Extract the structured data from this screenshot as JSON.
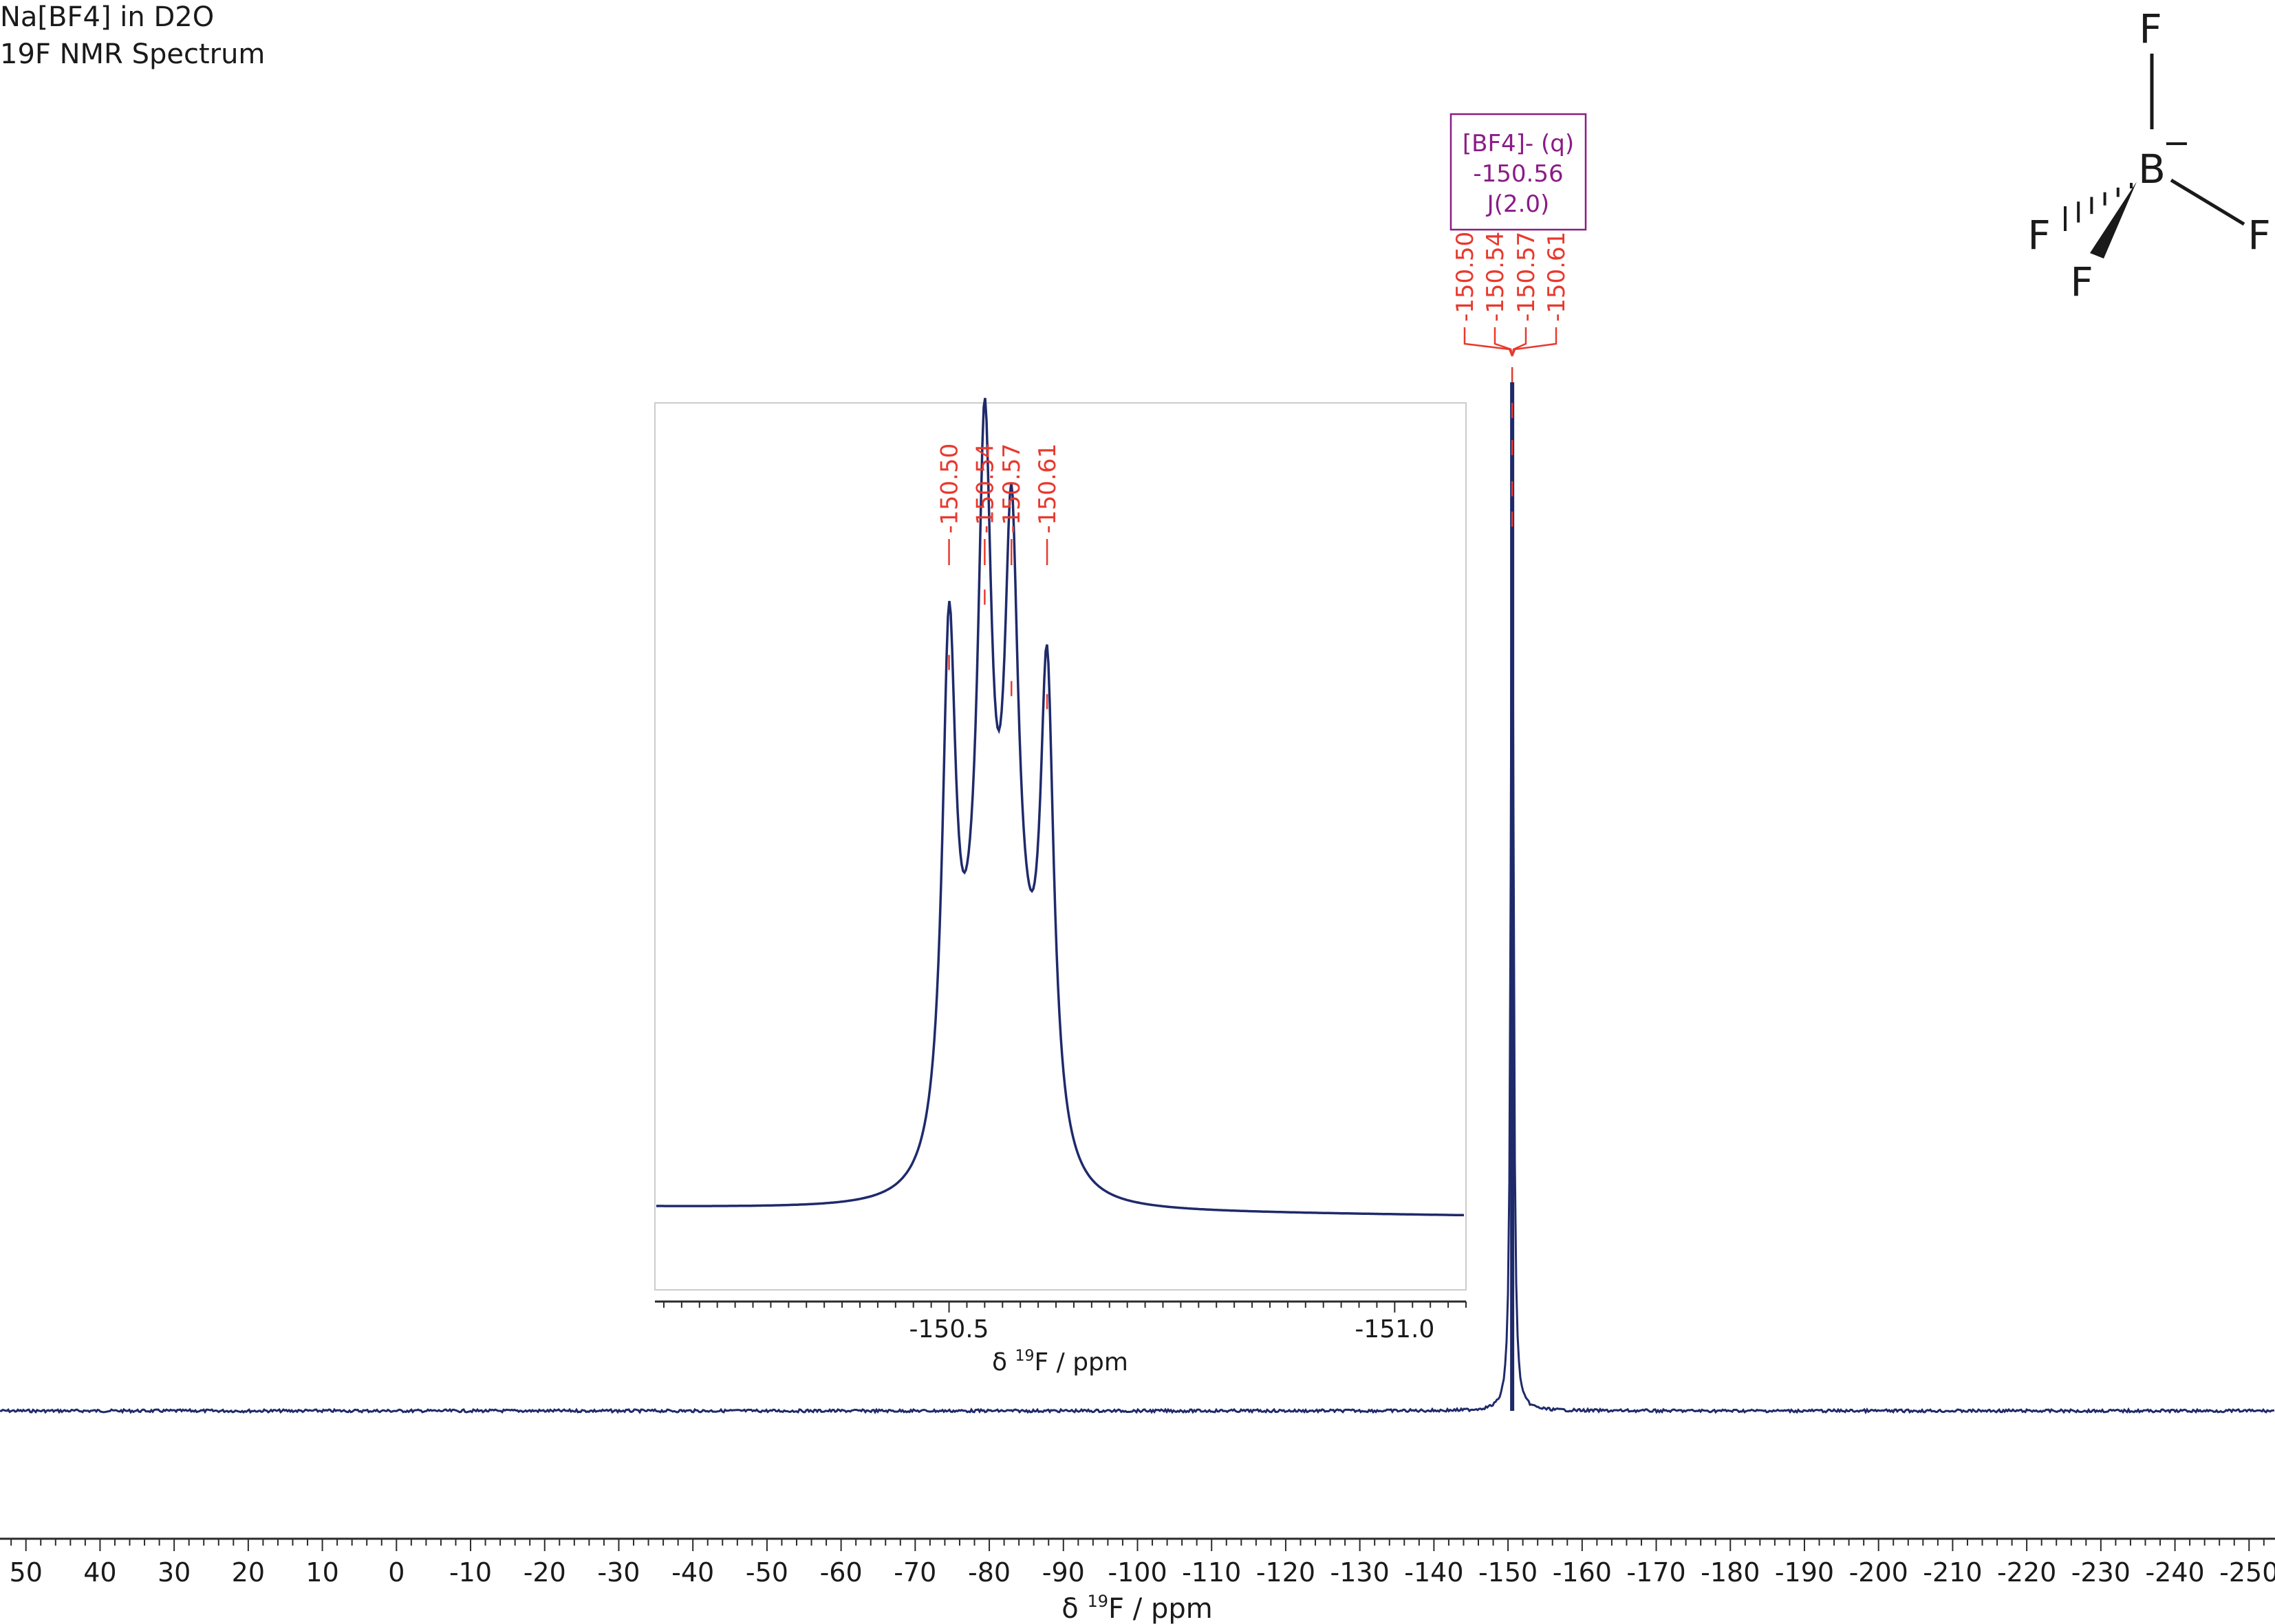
{
  "title": {
    "line1": "Na[BF4] in D2O",
    "line2": "19F NMR Spectrum"
  },
  "colors": {
    "spectrum": "#1f2a6b",
    "peak_label": "#e8392e",
    "annotation": "#8a1c86",
    "axis": "#2b2b2b",
    "inset_frame": "#cccccc",
    "structure": "#1a1a1a"
  },
  "annotation": {
    "line1": "[BF4]- (q)",
    "line2": "-150.56",
    "line3": "J(2.0)"
  },
  "structure": {
    "atoms": [
      "F",
      "F",
      "F",
      "F",
      "B"
    ],
    "charge": "−"
  },
  "chart_data": [
    {
      "type": "line",
      "name": "main-spectrum",
      "xlabel": "δ ¹⁹F / ppm",
      "xlabel_parts": {
        "prefix": "δ ",
        "sup": "19",
        "suffix": "F / ppm"
      },
      "xlim": [
        53.5,
        -253.5
      ],
      "x_reversed": true,
      "ticks": [
        50,
        40,
        30,
        20,
        10,
        0,
        -10,
        -20,
        -30,
        -40,
        -50,
        -60,
        -70,
        -80,
        -90,
        -100,
        -110,
        -120,
        -130,
        -140,
        -150,
        -160,
        -170,
        -180,
        -190,
        -200,
        -210,
        -220,
        -230,
        -240,
        -250
      ],
      "tick_labels": [
        "50",
        "40",
        "30",
        "20",
        "10",
        "0",
        "-10",
        "-20",
        "-30",
        "-40",
        "-50",
        "-60",
        "-70",
        "-80",
        "-90",
        "-100",
        "-110",
        "-120",
        "-130",
        "-140",
        "-150",
        "-160",
        "-170",
        "-180",
        "-190",
        "-200",
        "-210",
        "-220",
        "-230",
        "-240",
        "-250"
      ],
      "minor_tick_step": 2,
      "peak": {
        "center": -150.56,
        "relative_height": 1.0
      },
      "peak_labels": [
        "-150.50",
        "-150.54",
        "-150.57",
        "-150.61"
      ],
      "peak_positions": [
        -150.5,
        -150.54,
        -150.57,
        -150.61
      ],
      "grid": false
    },
    {
      "type": "line",
      "name": "inset-spectrum",
      "xlabel": "δ ¹⁹F / ppm",
      "xlabel_parts": {
        "prefix": "δ ",
        "sup": "19",
        "suffix": "F / ppm"
      },
      "xlim": [
        -150.17,
        -151.08
      ],
      "x_reversed": true,
      "ticks": [
        -150.5,
        -151.0
      ],
      "tick_labels": [
        "-150.5",
        "-151.0"
      ],
      "minor_tick_step": 0.02,
      "peaks": [
        {
          "position": -150.5,
          "label": "-150.50",
          "relative_height": 0.76
        },
        {
          "position": -150.54,
          "label": "-150.54",
          "relative_height": 0.86
        },
        {
          "position": -150.57,
          "label": "-150.57",
          "relative_height": 0.72
        },
        {
          "position": -150.61,
          "label": "-150.61",
          "relative_height": 0.7
        }
      ],
      "line_width_ppm": 0.009,
      "broad_base": {
        "center": -150.555,
        "width_ppm": 0.05,
        "relative_height": 0.28
      },
      "baseline_slope": 0.012,
      "grid": false
    }
  ]
}
